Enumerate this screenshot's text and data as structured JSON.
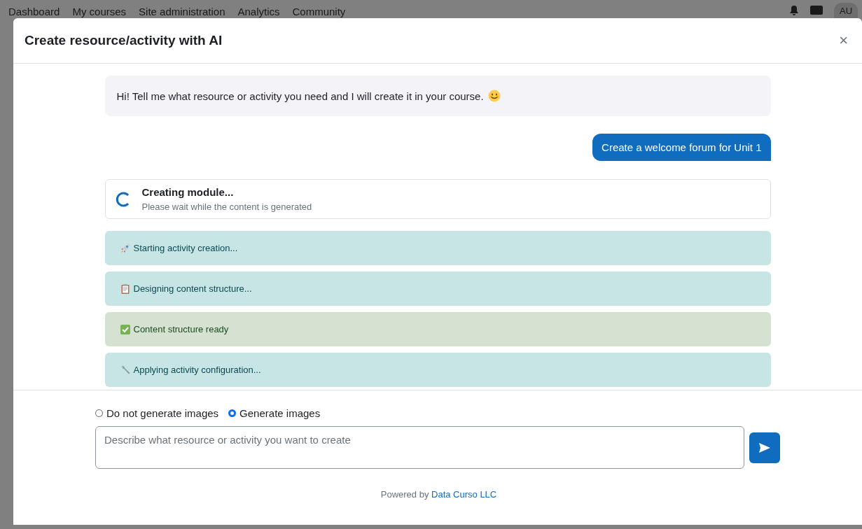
{
  "background_nav": {
    "items": [
      "Dashboard",
      "My courses",
      "Site administration",
      "Analytics",
      "Community"
    ],
    "avatar": "AU"
  },
  "dialog": {
    "title": "Create resource/activity with AI",
    "close": "×"
  },
  "messages": [
    {
      "kind": "bot",
      "text": "Hi! Tell me what resource or activity you need and I will create it in your course."
    },
    {
      "kind": "user",
      "text": "Create a welcome forum for Unit 1"
    }
  ],
  "progress": {
    "title": "Creating module...",
    "subtitle": "Please wait while the content is generated"
  },
  "steps": [
    {
      "kind": "info",
      "text": "Starting activity creation..."
    },
    {
      "kind": "info",
      "text": "Designing content structure..."
    },
    {
      "kind": "success",
      "text": "Content structure ready"
    },
    {
      "kind": "info",
      "text": "Applying activity configuration..."
    }
  ],
  "image_options": [
    {
      "label": "Do not generate images",
      "selected": false
    },
    {
      "label": "Generate images",
      "selected": true
    }
  ],
  "prompt": {
    "placeholder": "Describe what resource or activity you want to create"
  },
  "footer": {
    "text": "Powered by",
    "link": "Data Curso LLC"
  }
}
